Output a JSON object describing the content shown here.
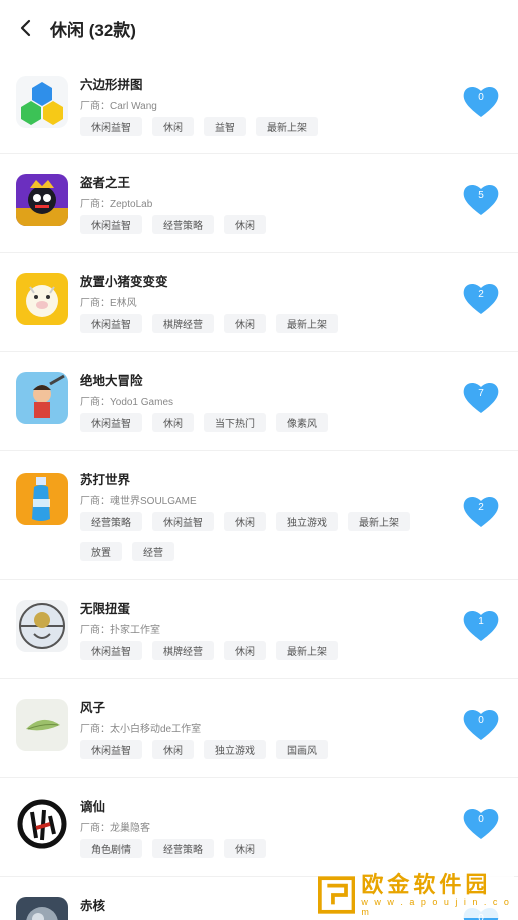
{
  "header": {
    "title": "休闲 (32款)"
  },
  "vendor_prefix": "厂商：",
  "games": [
    {
      "name": "六边形拼图",
      "vendor": "Carl Wang",
      "tags": [
        "休闲益智",
        "休闲",
        "益智",
        "最新上架"
      ],
      "likes": "0",
      "icon": "hexagon-puzzle-icon"
    },
    {
      "name": "盗者之王",
      "vendor": "ZeptoLab",
      "tags": [
        "休闲益智",
        "经营策略",
        "休闲"
      ],
      "likes": "5",
      "icon": "king-of-thieves-icon"
    },
    {
      "name": "放置小猪变变变",
      "vendor": "E林风",
      "tags": [
        "休闲益智",
        "棋牌经营",
        "休闲",
        "最新上架"
      ],
      "likes": "2",
      "icon": "idle-pig-icon"
    },
    {
      "name": "绝地大冒险",
      "vendor": "Yodo1 Games",
      "tags": [
        "休闲益智",
        "休闲",
        "当下热门",
        "像素风"
      ],
      "likes": "7",
      "icon": "adventure-hero-icon"
    },
    {
      "name": "苏打世界",
      "vendor": "魂世界SOULGAME",
      "tags": [
        "经营策略",
        "休闲益智",
        "休闲",
        "独立游戏",
        "最新上架",
        "放置",
        "经营"
      ],
      "likes": "2",
      "icon": "soda-bottle-icon"
    },
    {
      "name": "无限扭蛋",
      "vendor": "扑家工作室",
      "tags": [
        "休闲益智",
        "棋牌经营",
        "休闲",
        "最新上架"
      ],
      "likes": "1",
      "icon": "gacha-capsule-icon"
    },
    {
      "name": "风子",
      "vendor": "太小白移动de工作室",
      "tags": [
        "休闲益智",
        "休闲",
        "独立游戏",
        "国画风"
      ],
      "likes": "0",
      "icon": "leaf-painting-icon"
    },
    {
      "name": "谪仙",
      "vendor": "龙巢隐客",
      "tags": [
        "角色剧情",
        "经营策略",
        "休闲"
      ],
      "likes": "0",
      "icon": "ink-calligraphy-icon"
    },
    {
      "name": "赤核",
      "vendor": "",
      "tags": [],
      "likes": "0",
      "icon": "metal-sphere-icon"
    }
  ],
  "watermark": {
    "title": "欧金软件园",
    "url": "w w w . a p o u j i n . c o m"
  },
  "colors": {
    "heart": "#3fa9f5",
    "tag_bg": "#f3f4f6",
    "watermark": "#e8a400"
  }
}
